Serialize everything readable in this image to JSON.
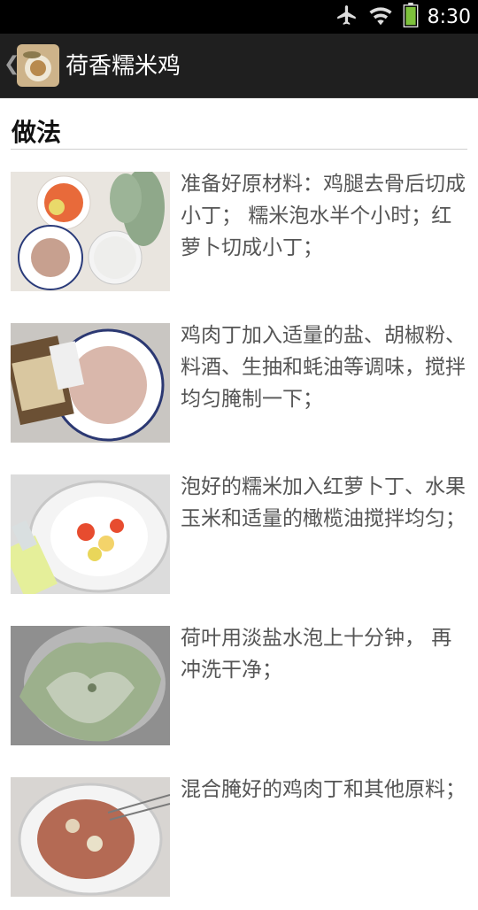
{
  "status": {
    "time": "8:30"
  },
  "appbar": {
    "title": "荷香糯米鸡"
  },
  "section": {
    "title": "做法"
  },
  "steps": [
    {
      "text": "准备好原材料：鸡腿去骨后切成小丁； 糯米泡水半个小时；红萝卜切成小丁；"
    },
    {
      "text": "鸡肉丁加入适量的盐、胡椒粉、料酒、生抽和蚝油等调味，搅拌均匀腌制一下；"
    },
    {
      "text": "泡好的糯米加入红萝卜丁、水果玉米和适量的橄榄油搅拌均匀；"
    },
    {
      "text": "荷叶用淡盐水泡上十分钟， 再冲洗干净；"
    },
    {
      "text": "混合腌好的鸡肉丁和其他原料；"
    }
  ],
  "icons": [
    "airplane-icon",
    "wifi-icon",
    "battery-icon",
    "back-chevron-icon",
    "app-icon"
  ]
}
